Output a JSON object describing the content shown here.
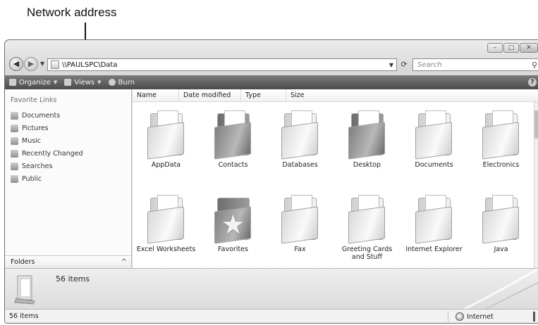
{
  "callout": {
    "label": "Network address"
  },
  "window": {
    "caption": {
      "minimize": "–",
      "maximize": "□",
      "close": "✕"
    },
    "address": {
      "path": "\\\\PAULSPC\\Data"
    },
    "search": {
      "placeholder": "Search"
    },
    "toolbar": {
      "organize": "Organize",
      "views": "Views",
      "burn": "Burn",
      "help": "?"
    },
    "nav_pane": {
      "title": "Favorite Links",
      "items": [
        {
          "label": "Documents",
          "icon": "documents-icon"
        },
        {
          "label": "Pictures",
          "icon": "pictures-icon"
        },
        {
          "label": "Music",
          "icon": "music-icon"
        },
        {
          "label": "Recently Changed",
          "icon": "recently-changed-icon"
        },
        {
          "label": "Searches",
          "icon": "searches-icon"
        },
        {
          "label": "Public",
          "icon": "public-icon"
        }
      ],
      "folders_label": "Folders"
    },
    "columns": [
      "Name",
      "Date modified",
      "Type",
      "Size"
    ],
    "items": [
      {
        "label": "AppData",
        "style": "light"
      },
      {
        "label": "Contacts",
        "style": "dark"
      },
      {
        "label": "Databases",
        "style": "light"
      },
      {
        "label": "Desktop",
        "style": "dark"
      },
      {
        "label": "Documents",
        "style": "light"
      },
      {
        "label": "Electronics",
        "style": "light"
      },
      {
        "label": "Excel Worksheets",
        "style": "light"
      },
      {
        "label": "Favorites",
        "style": "star"
      },
      {
        "label": "Fax",
        "style": "light"
      },
      {
        "label": "Greeting Cards and Stuff",
        "style": "light"
      },
      {
        "label": "Internet Explorer",
        "style": "light"
      },
      {
        "label": "Java",
        "style": "light"
      }
    ],
    "details": {
      "count": "56 items"
    },
    "status": {
      "left": "56 items",
      "zone": "Internet"
    }
  }
}
